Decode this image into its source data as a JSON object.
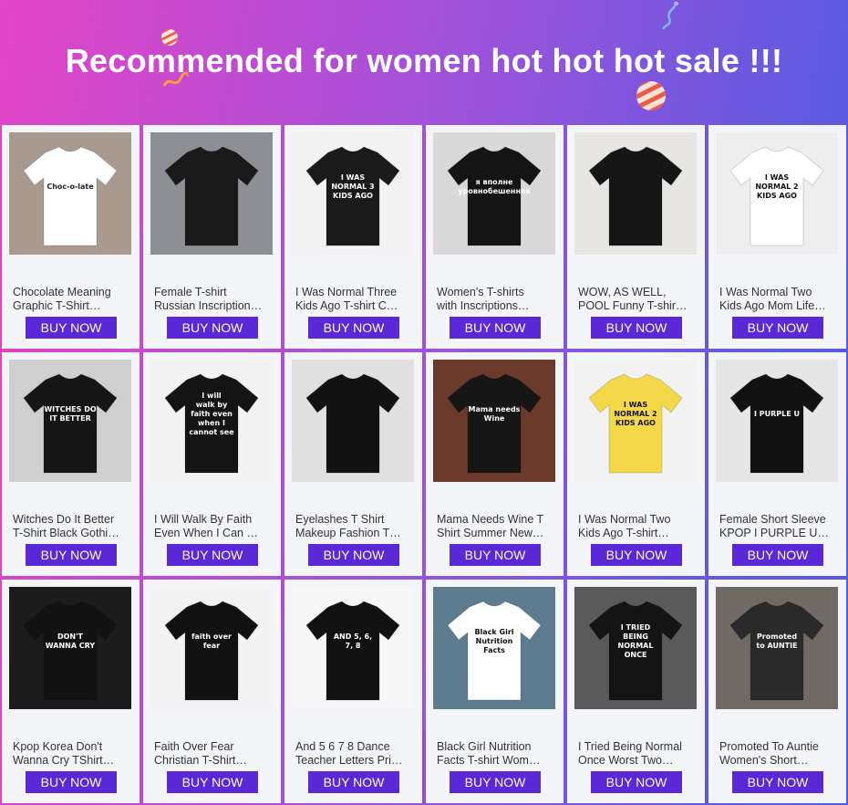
{
  "banner": {
    "title": "Recommended for women hot hot hot sale !!!"
  },
  "colors": {
    "button": "#5a28d6",
    "card_bg": "#f4f5f9",
    "gradient_left": "#e245c6",
    "gradient_right": "#4f5ce2"
  },
  "products": [
    {
      "name": "Chocolate Meaning\nGraphic T-Shirt…",
      "button": "BUY NOW",
      "shirt": "#ffffff",
      "bg": "#a89a8e",
      "print": "Choc-o-late",
      "ink": "#222222"
    },
    {
      "name": "Female T-shirt\nRussian Inscription…",
      "button": "BUY NOW",
      "shirt": "#1a1a1a",
      "bg": "#8d8f94",
      "print": "",
      "ink": "#ffffff"
    },
    {
      "name": "I Was Normal Three\nKids Ago T-shirt C…",
      "button": "BUY NOW",
      "shirt": "#1a1a1a",
      "bg": "#f2f2f2",
      "print": "I WAS NORMAL 3 KIDS AGO",
      "ink": "#ffffff"
    },
    {
      "name": "Women's T-shirts\nwith Inscriptions…",
      "button": "BUY NOW",
      "shirt": "#141414",
      "bg": "#d9d9d9",
      "print": "я вполне уровнобешенная",
      "ink": "#ffffff"
    },
    {
      "name": "WOW, AS WELL,\nPOOL Funny T-shir…",
      "button": "BUY NOW",
      "shirt": "#161616",
      "bg": "#e8e6e2",
      "print": "",
      "ink": "#ffffff"
    },
    {
      "name": "I Was Normal Two\nKids Ago Mom Life…",
      "button": "BUY NOW",
      "shirt": "#ffffff",
      "bg": "#eeeeee",
      "print": "I WAS NORMAL 2 KIDS AGO",
      "ink": "#111111"
    },
    {
      "name": "Witches Do It Better\nT-Shirt Black Gothi…",
      "button": "BUY NOW",
      "shirt": "#161616",
      "bg": "#cfcfcf",
      "print": "WITCHES DO IT BETTER",
      "ink": "#ffffff"
    },
    {
      "name": "I Will Walk By Faith\nEven When I Can …",
      "button": "BUY NOW",
      "shirt": "#141414",
      "bg": "#f3f3f3",
      "print": "I will walk by faith even when I cannot see",
      "ink": "#ffffff"
    },
    {
      "name": "Eyelashes T Shirt\nMakeup Fashion T…",
      "button": "BUY NOW",
      "shirt": "#121212",
      "bg": "#e0e0e0",
      "print": "",
      "ink": "#ffffff"
    },
    {
      "name": "Mama Needs Wine T\nShirt Summer New…",
      "button": "BUY NOW",
      "shirt": "#161616",
      "bg": "#6b3a2a",
      "print": "Mama needs Wine",
      "ink": "#ffffff"
    },
    {
      "name": "I Was Normal Two\nKids Ago T-shirt…",
      "button": "BUY NOW",
      "shirt": "#f5d84a",
      "bg": "#f2f2f2",
      "print": "I WAS NORMAL 2 KIDS AGO",
      "ink": "#111111"
    },
    {
      "name": "Female Short Sleeve\nKPOP I PURPLE U…",
      "button": "BUY NOW",
      "shirt": "#121212",
      "bg": "#e6e6e6",
      "print": "I PURPLE U",
      "ink": "#ffffff"
    },
    {
      "name": "Kpop Korea Don't\nWanna Cry TShirt…",
      "button": "BUY NOW",
      "shirt": "#121212",
      "bg": "#1c1c1c",
      "print": "DON'T WANNA CRY",
      "ink": "#ffffff"
    },
    {
      "name": "Faith Over Fear\nChristian T-Shirt…",
      "button": "BUY NOW",
      "shirt": "#111111",
      "bg": "#f3f3f3",
      "print": "faith over fear",
      "ink": "#ffffff"
    },
    {
      "name": "And 5 6 7 8 Dance\nTeacher Letters Pri…",
      "button": "BUY NOW",
      "shirt": "#111111",
      "bg": "#f7f7f7",
      "print": "AND 5, 6, 7, 8",
      "ink": "#ffffff"
    },
    {
      "name": "Black Girl Nutrition\nFacts T-shirt Wom…",
      "button": "BUY NOW",
      "shirt": "#ffffff",
      "bg": "#5e7c8f",
      "print": "Black Girl Nutrition Facts",
      "ink": "#111111"
    },
    {
      "name": "I Tried Being Normal\nOnce Worst Two…",
      "button": "BUY NOW",
      "shirt": "#141414",
      "bg": "#5a5a5a",
      "print": "I TRIED BEING NORMAL ONCE",
      "ink": "#ffffff"
    },
    {
      "name": "Promoted To Auntie\nWomen's Short…",
      "button": "BUY NOW",
      "shirt": "#2a2a2a",
      "bg": "#6f6a64",
      "print": "Promoted to AUNTIE",
      "ink": "#ffffff"
    }
  ]
}
